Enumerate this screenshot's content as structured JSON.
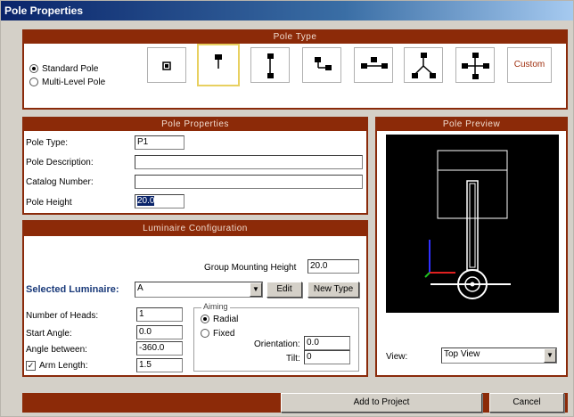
{
  "window": {
    "title": "Pole Properties"
  },
  "pole_type": {
    "header": "Pole Type",
    "options": [
      {
        "label": "Standard Pole",
        "selected": true
      },
      {
        "label": "Multi-Level Pole",
        "selected": false
      }
    ],
    "custom_label": "Custom"
  },
  "pole_properties": {
    "header": "Pole Properties",
    "type_label": "Pole Type:",
    "type_value": "P1",
    "description_label": "Pole Description:",
    "description_value": "",
    "catalog_label": "Catalog Number:",
    "catalog_value": "",
    "height_label": "Pole Height",
    "height_value": "20.0"
  },
  "pole_preview": {
    "header": "Pole Preview",
    "view_label": "View:",
    "view_value": "Top View"
  },
  "luminaire": {
    "header": "Luminaire Configuration",
    "group_height_label": "Group Mounting Height",
    "group_height_value": "20.0",
    "selected_label": "Selected Luminaire:",
    "selected_value": "A",
    "edit_label": "Edit",
    "new_type_label": "New Type",
    "heads_label": "Number of Heads:",
    "heads_value": "1",
    "start_angle_label": "Start Angle:",
    "start_angle_value": "0.0",
    "angle_between_label": "Angle between:",
    "angle_between_value": "-360.0",
    "arm_length_label": "Arm Length:",
    "arm_length_value": "1.5",
    "arm_length_checked": true,
    "aiming": {
      "legend": "Aiming",
      "radial_label": "Radial",
      "fixed_label": "Fixed",
      "radial_selected": true,
      "orientation_label": "Orientation:",
      "orientation_value": "0.0",
      "tilt_label": "Tilt:",
      "tilt_value": "0"
    }
  },
  "footer": {
    "add_label": "Add to Project",
    "cancel_label": "Cancel"
  }
}
